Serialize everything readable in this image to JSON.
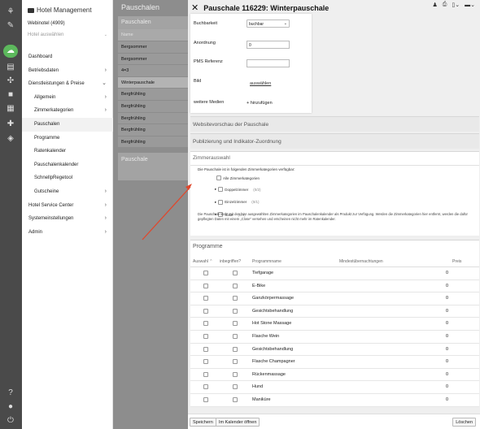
{
  "rail": {
    "icons": [
      "tree-icon",
      "pencil-icon",
      "cloud-icon",
      "chat-icon",
      "share-icon",
      "briefcase-icon",
      "book-icon",
      "wrench-icon",
      "shield-icon",
      "help-icon",
      "user-icon",
      "power-icon"
    ]
  },
  "nav": {
    "brand": "Hotel Management",
    "hotel_name": "Webinotel (4909)",
    "hotel_select": "Hotel auswählen",
    "items": [
      {
        "label": "Dashboard",
        "sub": false,
        "chev": ""
      },
      {
        "label": "Betriebsdaten",
        "sub": false,
        "chev": "›"
      },
      {
        "label": "Dienstleistungen & Preise",
        "sub": false,
        "chev": "⌄"
      },
      {
        "label": "Allgemein",
        "sub": true,
        "chev": "›"
      },
      {
        "label": "Zimmerkategorien",
        "sub": true,
        "chev": "›"
      },
      {
        "label": "Pauschalen",
        "sub": true,
        "chev": "",
        "selected": true
      },
      {
        "label": "Programme",
        "sub": true,
        "chev": ""
      },
      {
        "label": "Ratenkalender",
        "sub": true,
        "chev": ""
      },
      {
        "label": "Pauschalenkalender",
        "sub": true,
        "chev": ""
      },
      {
        "label": "SchnellpRegetool",
        "sub": true,
        "chev": ""
      },
      {
        "label": "Gutscheine",
        "sub": true,
        "chev": "›"
      },
      {
        "label": "Hotel Service Center",
        "sub": false,
        "chev": "›"
      },
      {
        "label": "Systemeinstellungen",
        "sub": false,
        "chev": "›"
      },
      {
        "label": "Admin",
        "sub": false,
        "chev": "›"
      }
    ]
  },
  "list": {
    "page_title": "Pauschalen",
    "header": "Pauschalen",
    "col_name": "Name",
    "rows": [
      "Bergsommer",
      "Bergsommer",
      "4=3",
      "Winterpauschale",
      "Bergfrühling",
      "Bergfrühling",
      "Bergfrühling",
      "Bergfrühling",
      "Bergfrühling"
    ],
    "selected_index": 3,
    "second_header": "Pauschale"
  },
  "detail": {
    "title": "Pauschale 116229: Winterpauschale",
    "fields": {
      "buchbarkeit_label": "Buchbarkeit",
      "buchbarkeit_value": "buchbar",
      "anordnung_label": "Anordnung",
      "anordnung_value": "0",
      "pms_label": "PMS Referenz",
      "pms_value": "",
      "bild_label": "Bild",
      "bild_link": "auswählen",
      "medien_label": "weitere Medien",
      "medien_link": "+ hinzufügen"
    },
    "sections": {
      "vorschau": "Websitevorschau der Pauschale",
      "publizierung": "Publizierung und Indikator-Zuordnung"
    },
    "zimmer": {
      "title": "Zimmerauswahl",
      "desc": "Die Pauschale ist in folgenden Zimmerkategorien verfügbar:",
      "all": "Alle Zimmerkategorien",
      "options": [
        {
          "label": "Doppelzimmer",
          "count": "(0/2)"
        },
        {
          "label": "Einzelzimmer",
          "count": "(0/1)"
        },
        {
          "label": "Suite",
          "count": "(0/1)"
        }
      ],
      "info": "Die Pauschale steht mit den hier ausgewählten Zimmerkategorien im Pauschalenkalender als Produkt zur Verfügung. Werden die Zimmerkategorien hier entfernt, werden die dafür gepflegten Daten mit einem „Close“ versehen und erscheinen nicht mehr im Ratenkalender."
    },
    "programme": {
      "title": "Programme",
      "col_auswahl": "Auswahl ⌃",
      "col_inbegriffen": "inbegriffen?",
      "col_name": "Programmname",
      "col_min": "Mindestübernachtungen",
      "col_preis": "Preis",
      "rows": [
        {
          "name": "Tiefgarage",
          "price": "0"
        },
        {
          "name": "E-Bike",
          "price": "0"
        },
        {
          "name": "Ganzkörpermassage",
          "price": "0"
        },
        {
          "name": "Gesichtsbehandlung",
          "price": "0"
        },
        {
          "name": "Hot Stone Massage",
          "price": "0"
        },
        {
          "name": "Flasche Wein",
          "price": "0"
        },
        {
          "name": "Gesichtsbehandlung",
          "price": "0"
        },
        {
          "name": "Flasche Champagner",
          "price": "0"
        },
        {
          "name": "Rückenmassage",
          "price": "0"
        },
        {
          "name": "Hund",
          "price": "0"
        },
        {
          "name": "Maniküre",
          "price": "0"
        }
      ]
    },
    "footer": {
      "save": "Speichern",
      "calendar": "Im Kalender öffnen",
      "delete": "Löschen"
    }
  },
  "colors": {
    "rail": "#4a4a4a",
    "accent_green": "#5cb85c",
    "arrow_red": "#e0472c"
  }
}
